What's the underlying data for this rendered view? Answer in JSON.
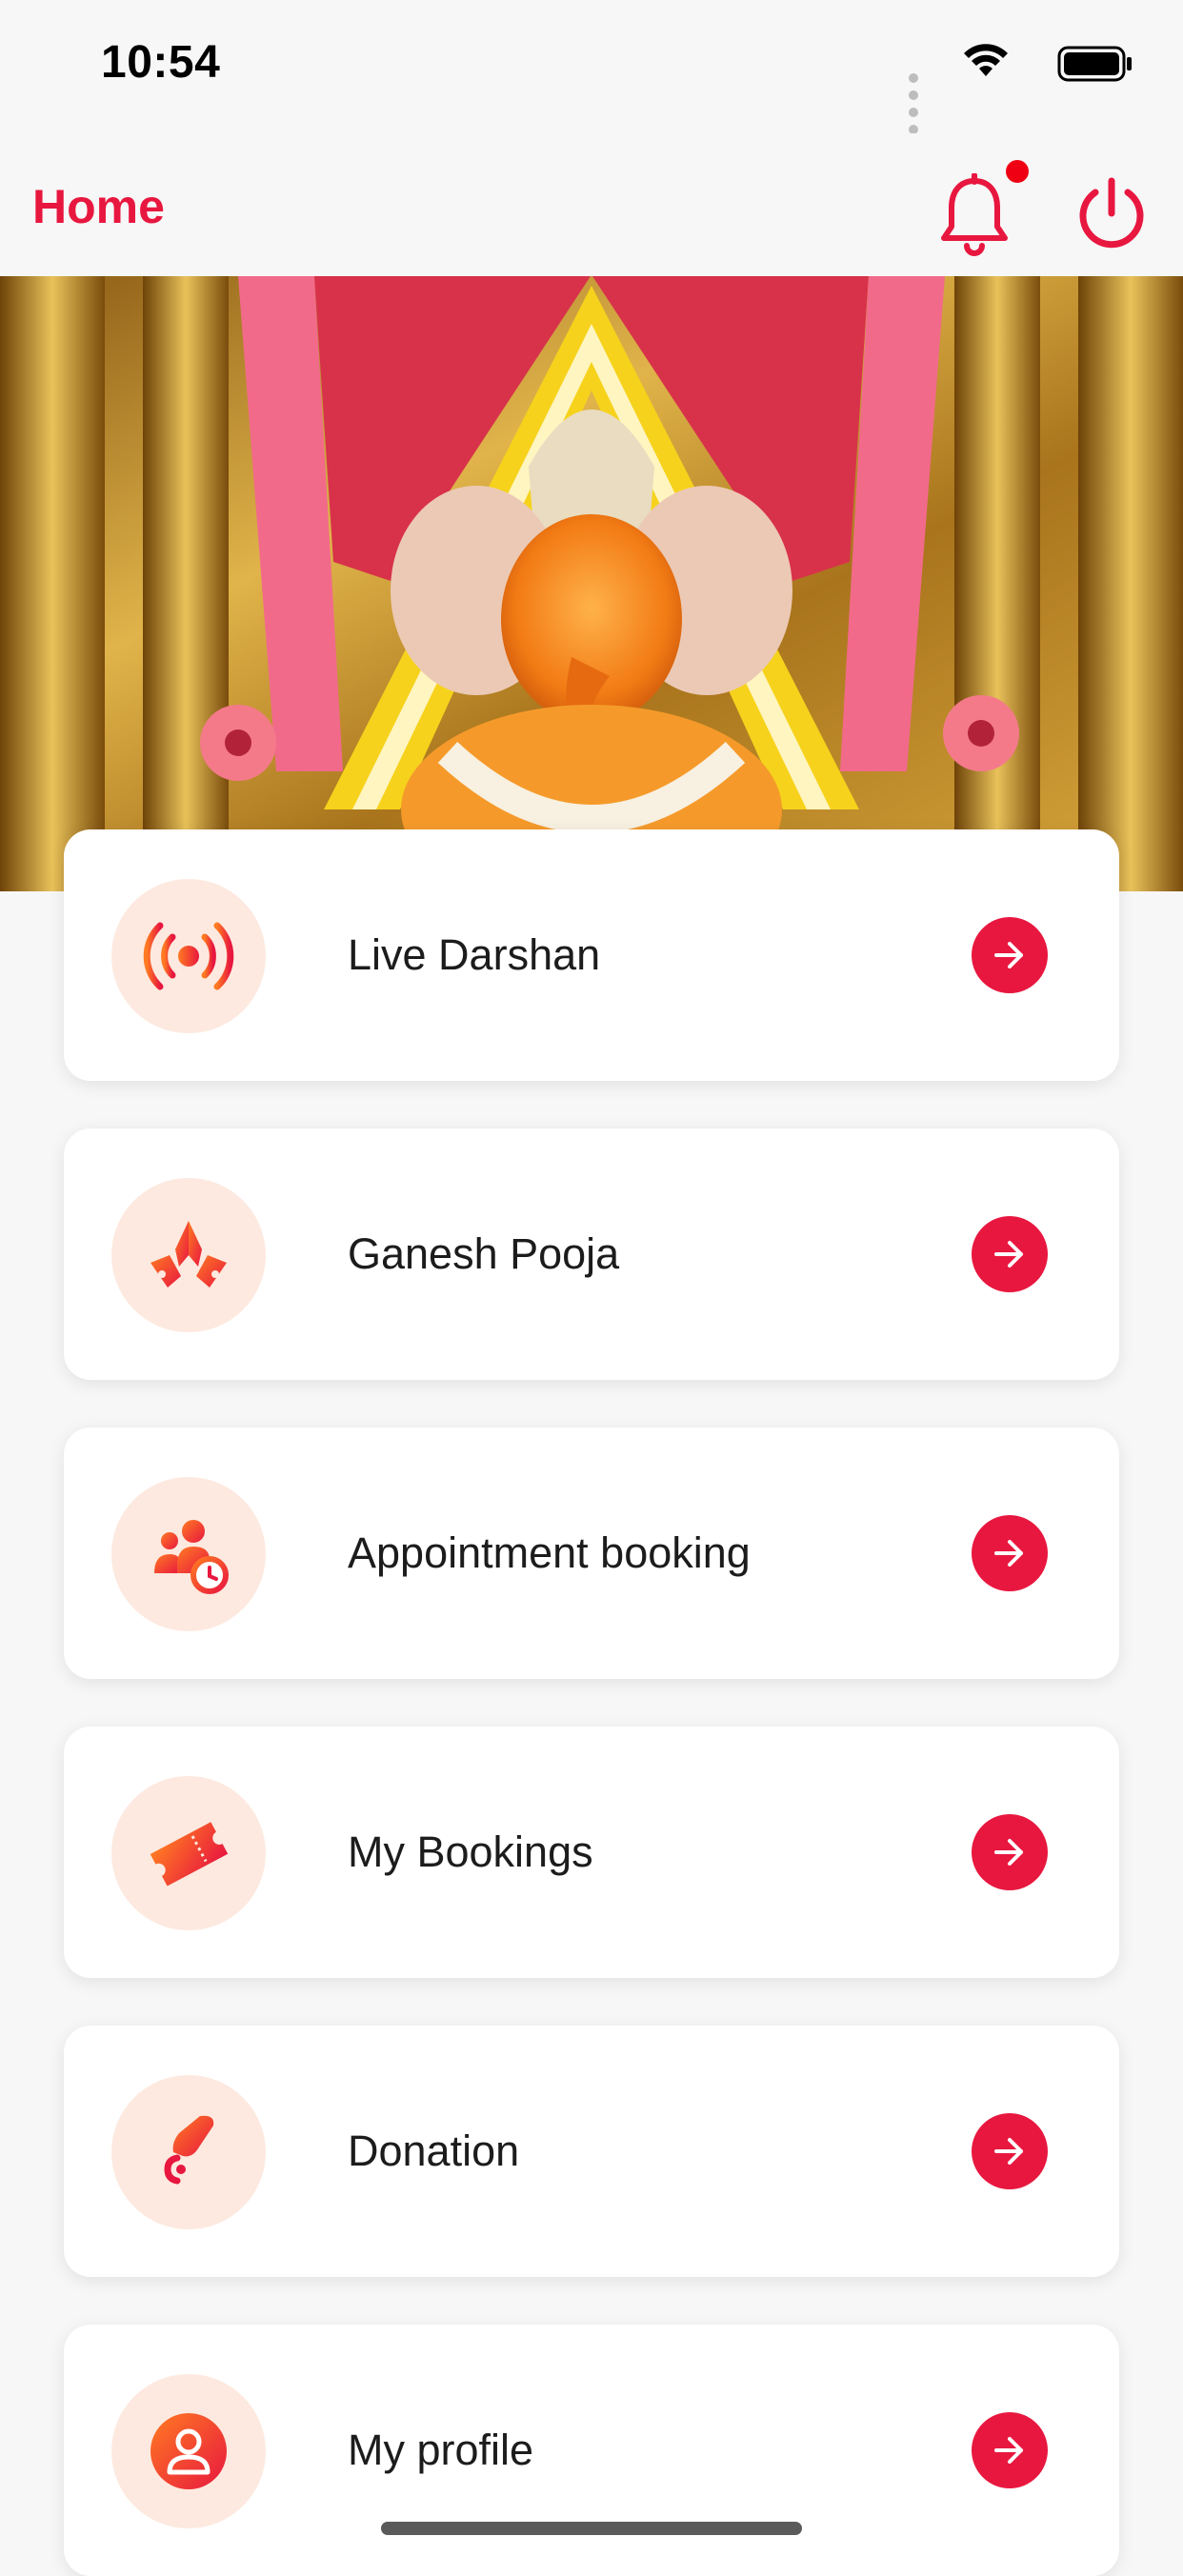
{
  "status_bar": {
    "time": "10:54",
    "icons": [
      "signal-icon",
      "wifi-icon",
      "battery-icon"
    ]
  },
  "header": {
    "title": "Home",
    "notification_icon": "bell-icon",
    "has_unread_notifications": true,
    "logout_icon": "power-icon"
  },
  "hero": {
    "image": "temple-deity-banner"
  },
  "menu": {
    "items": [
      {
        "label": "Live Darshan",
        "icon": "live-broadcast-icon"
      },
      {
        "label": "Ganesh Pooja",
        "icon": "folded-hands-icon"
      },
      {
        "label": "Appointment booking",
        "icon": "group-clock-icon"
      },
      {
        "label": "My Bookings",
        "icon": "ticket-icon"
      },
      {
        "label": "Donation",
        "icon": "donate-hand-icon"
      },
      {
        "label": "My profile",
        "icon": "user-profile-icon"
      }
    ]
  },
  "colors": {
    "accent": "#e8173f",
    "icon_bg": "#fde9df",
    "icon_gradient_start": "#ff7a22",
    "icon_gradient_end": "#e8173f",
    "background": "#f7f7f7"
  }
}
